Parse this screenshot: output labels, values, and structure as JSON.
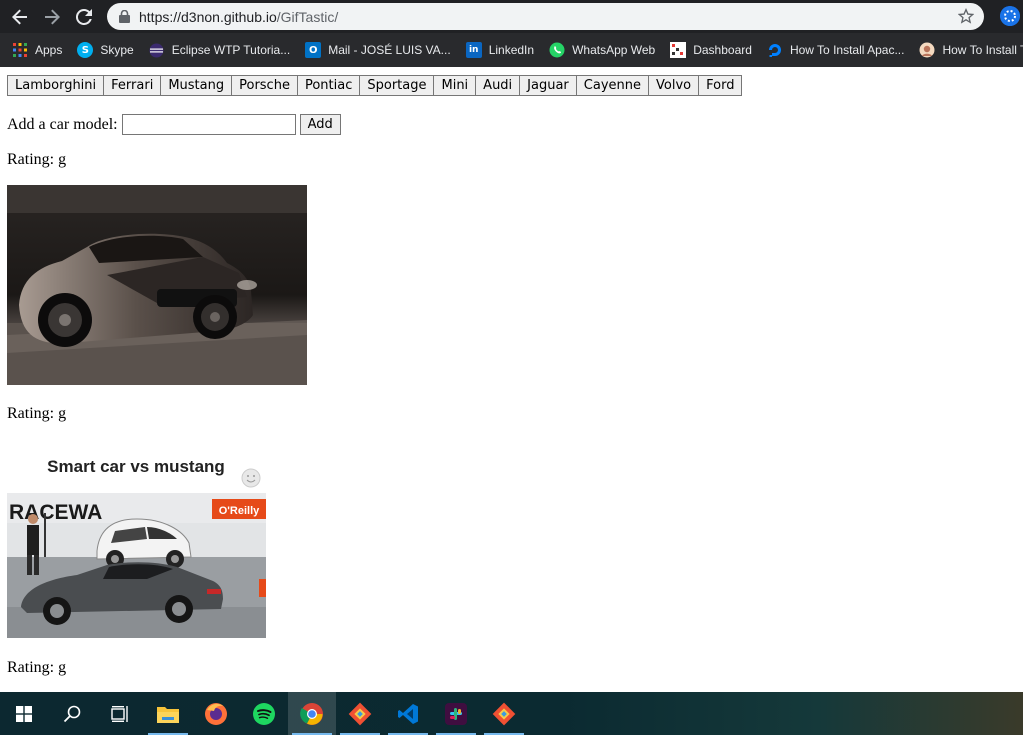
{
  "browser": {
    "url_host": "https://d3non.github.io",
    "url_path": "/GifTastic/"
  },
  "bookmarks": [
    {
      "label": "Apps",
      "icon": "apps-grid-icon",
      "color": "#ea4335"
    },
    {
      "label": "Skype",
      "icon": "skype-icon",
      "color": "#00aff0"
    },
    {
      "label": "Eclipse WTP Tutoria...",
      "icon": "eclipse-icon",
      "color": "#2c2255"
    },
    {
      "label": "Mail - JOSÉ LUIS VA...",
      "icon": "outlook-icon",
      "color": "#0072c6"
    },
    {
      "label": "LinkedIn",
      "icon": "linkedin-icon",
      "color": "#0a66c2"
    },
    {
      "label": "WhatsApp Web",
      "icon": "whatsapp-icon",
      "color": "#25d366"
    },
    {
      "label": "Dashboard",
      "icon": "dashboard-icon",
      "color": "#ffffff"
    },
    {
      "label": "How To Install Apac...",
      "icon": "digitalocean-icon",
      "color": "#0080ff"
    },
    {
      "label": "How To Install T",
      "icon": "howto-icon",
      "color": "#d9a07a"
    }
  ],
  "car_buttons": [
    "Lamborghini",
    "Ferrari",
    "Mustang",
    "Porsche",
    "Pontiac",
    "Sportage",
    "Mini",
    "Audi",
    "Jaguar",
    "Cayenne",
    "Volvo",
    "Ford"
  ],
  "form": {
    "label": "Add a car model:",
    "input_value": "",
    "add_label": "Add"
  },
  "results": [
    {
      "rating": "Rating: g"
    },
    {
      "rating": "Rating: g",
      "gif_caption": "Smart car vs mustang",
      "banner_text": "RACEWA",
      "sponsor_text": "O'Reilly"
    },
    {
      "rating": "Rating: g"
    }
  ],
  "taskbar": {
    "items": [
      "windows-start-icon",
      "search-icon",
      "task-view-icon",
      "file-explorer-icon",
      "firefox-icon",
      "spotify-icon",
      "chrome-icon",
      "git-icon",
      "vscode-icon",
      "slack-icon",
      "git-icon"
    ]
  }
}
